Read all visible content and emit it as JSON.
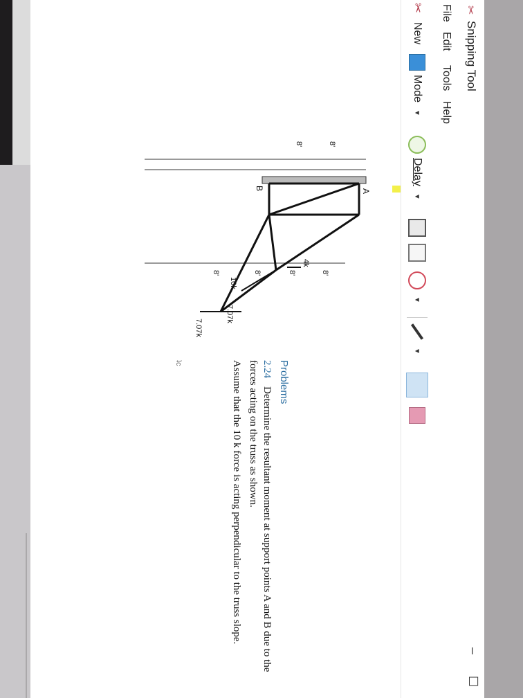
{
  "window": {
    "title": "Snipping Tool",
    "minimize_label": "–",
    "maximize_label": "☐"
  },
  "menu": [
    "File",
    "Edit",
    "Tools",
    "Help"
  ],
  "toolbar": {
    "new_label": "New",
    "mode_label": "Mode",
    "delay_label": "Delay"
  },
  "problem": {
    "heading": "Problems",
    "number": "2.24",
    "text": "Determine the resultant moment at support points A and B due to the forces acting on the truss as shown.",
    "note": "Assume that the 10 k force is acting perpendicular to the truss slope.",
    "mark": "ʇc"
  },
  "figure": {
    "labels": {
      "A": "A",
      "B": "B",
      "force_10": "10k",
      "force_4": "4k",
      "force_7_1": "7.07k",
      "force_7_2": "7.07k",
      "dim_8a": "8'",
      "dim_8b": "8'",
      "dim_8c": "8'",
      "dim_8d": "8'",
      "dim_8e": "8'",
      "dim_8f": "8'"
    }
  },
  "colors": {
    "accent": "#2a6da0",
    "highlight": "#f3f04a",
    "scissor_icon": "#b23a4a"
  }
}
